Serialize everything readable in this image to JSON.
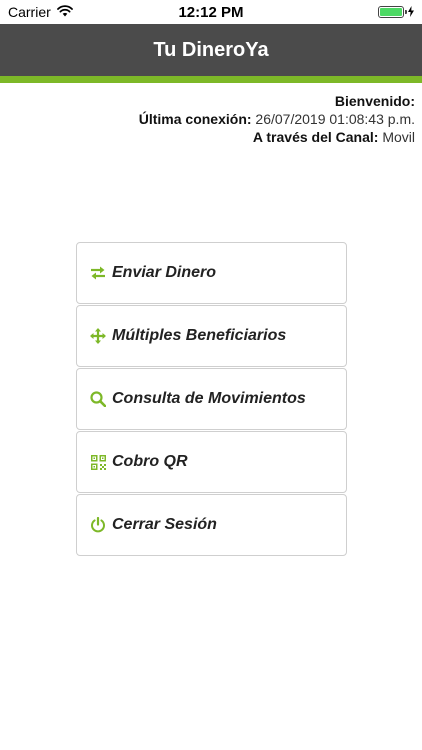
{
  "status_bar": {
    "carrier": "Carrier",
    "time": "12:12 PM",
    "icons": [
      "wifi-icon",
      "battery-icon",
      "charging-icon"
    ]
  },
  "header": {
    "title": "Tu DineroYa",
    "background_color": "#4b4b4b",
    "accent_color": "#7db828"
  },
  "session": {
    "welcome_label": "Bienvenido:",
    "welcome_value": "",
    "last_connection_label": "Última conexión:",
    "last_connection_value": "26/07/2019 01:08:43 p.m.",
    "channel_label": "A través del Canal:",
    "channel_value": "Movil"
  },
  "menu": {
    "icon_color": "#7db828",
    "items": [
      {
        "label": "Enviar Dinero",
        "icon": "transfer-arrows-icon"
      },
      {
        "label": "Múltiples Beneficiarios",
        "icon": "move-arrows-icon"
      },
      {
        "label": "Consulta de Movimientos",
        "icon": "search-icon"
      },
      {
        "label": "Cobro QR",
        "icon": "qr-code-icon"
      },
      {
        "label": "Cerrar Sesión",
        "icon": "power-icon"
      }
    ]
  }
}
